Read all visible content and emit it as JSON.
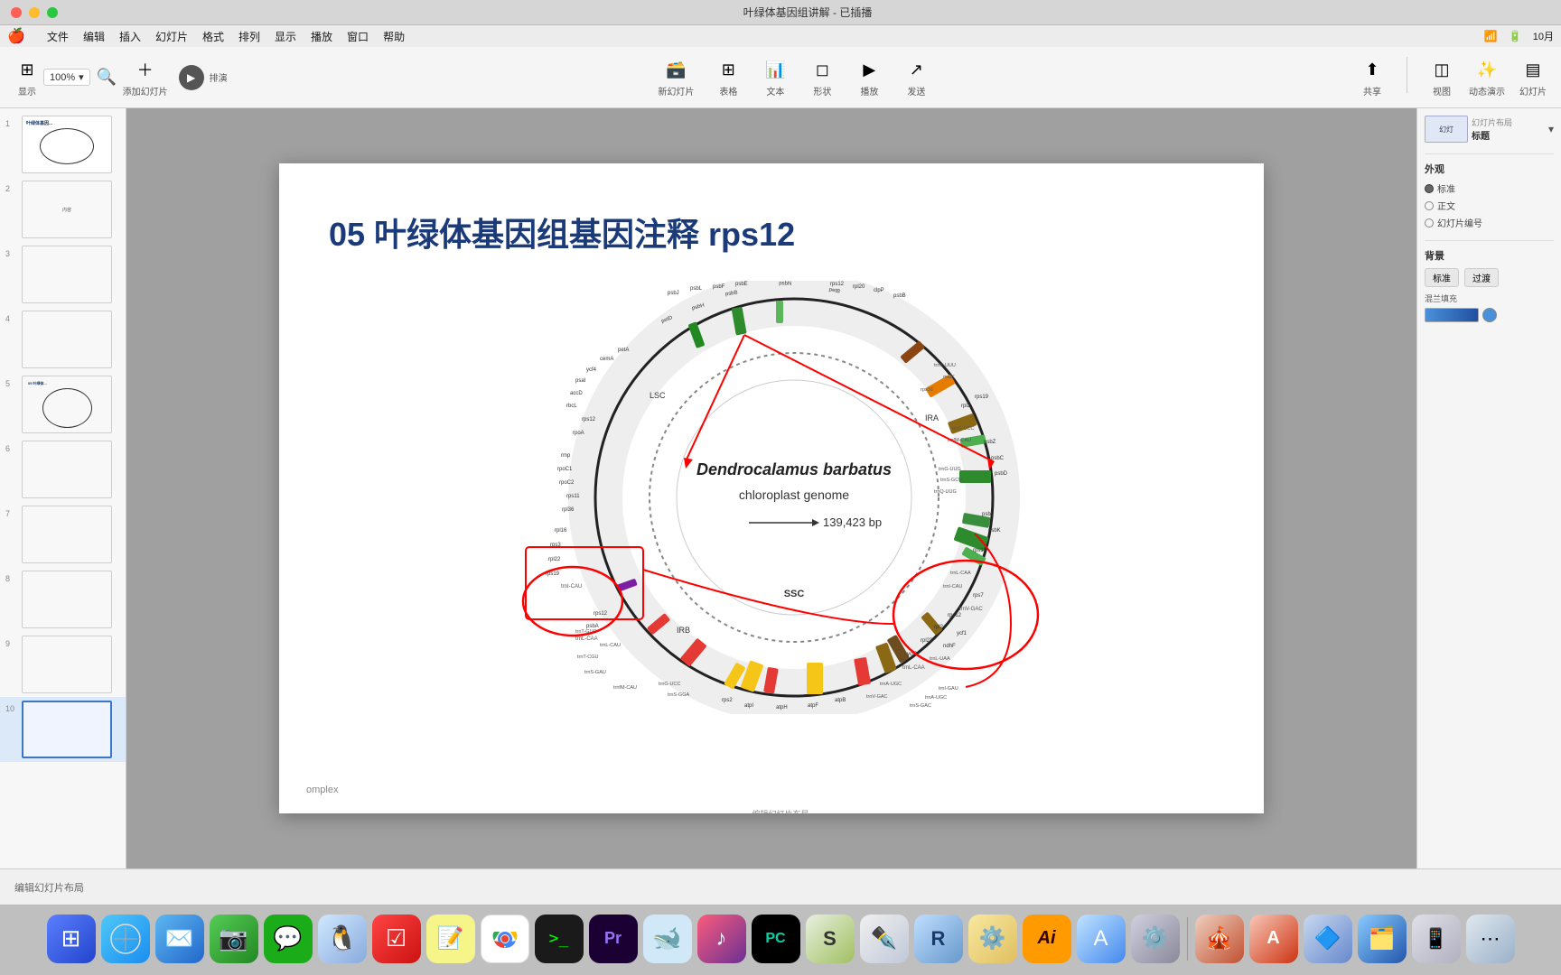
{
  "window": {
    "title": "叶绿体基因组讲解 - 已插播"
  },
  "menubar": {
    "apple": "🍎",
    "items": [
      "文件",
      "编辑",
      "插入",
      "幻灯片",
      "格式",
      "排列",
      "显示",
      "播放",
      "窗口",
      "帮助"
    ],
    "right_items": [
      "wifi-icon",
      "battery-icon",
      "clock-icon",
      "10月"
    ]
  },
  "toolbar": {
    "zoom_label": "100%",
    "display_label": "显示",
    "magnify_label": "缩放",
    "add_slide_label": "添加幻灯片",
    "play_label": "排演",
    "new_label": "新幻灯片",
    "table_label": "表格",
    "chart_label": "文本",
    "shapes_label": "形状",
    "operate_label": "播放",
    "send_label": "发送",
    "share_label": "共享",
    "view_label": "视图",
    "ai_tools_label": "动态演示",
    "slide_mgr_label": "幻灯片"
  },
  "slide": {
    "heading": "05 叶绿体基因组基因注释 rps12",
    "diagram": {
      "title_italic": "Dendrocalamus barbatus",
      "subtitle": "chlororoplast genome",
      "size": "139,423 bp",
      "inner_labels": [
        "LSC",
        "SSC",
        "IRB",
        "IRA"
      ]
    }
  },
  "right_panel": {
    "layout_section": "幻灯片布局",
    "layout_name": "标题",
    "appearance_title": "外观",
    "appearance_items": [
      "标准",
      "正文",
      "幻灯片编号"
    ],
    "background_title": "背景",
    "standard_btn": "标准",
    "transition_btn": "过渡",
    "color_label": "混兰填充",
    "footer_label": "编辑幻灯片布局"
  },
  "bottom_bar": {
    "status": "编辑幻灯片布局"
  },
  "dock": {
    "icons": [
      {
        "name": "launchpad",
        "emoji": "⊞",
        "color": "#e0e8f5",
        "label": "启动台"
      },
      {
        "name": "safari",
        "emoji": "🧭",
        "color": "#d0e8f8",
        "label": "Safari"
      },
      {
        "name": "mail",
        "emoji": "✉️",
        "color": "#d0e0f0",
        "label": "邮件"
      },
      {
        "name": "facetime",
        "emoji": "📷",
        "color": "#b8e8b8",
        "label": "FaceTime"
      },
      {
        "name": "wechat",
        "emoji": "💬",
        "color": "#b8e8b8",
        "label": "微信"
      },
      {
        "name": "qq",
        "emoji": "🐧",
        "color": "#d8e8f8",
        "label": "QQ"
      },
      {
        "name": "reminders",
        "emoji": "☑️",
        "color": "#f0e0d0",
        "label": "提醒事项"
      },
      {
        "name": "stickies",
        "emoji": "📝",
        "color": "#f8f0b0",
        "label": "便利贴"
      },
      {
        "name": "chrome",
        "emoji": "◎",
        "color": "#f0f0f0",
        "label": "Chrome"
      },
      {
        "name": "terminal",
        "emoji": "⬛",
        "color": "#222",
        "label": "终端"
      },
      {
        "name": "premiere",
        "emoji": "🎬",
        "color": "#200040",
        "label": "Premiere"
      },
      {
        "name": "docker",
        "emoji": "🐋",
        "color": "#d0e8f8",
        "label": "Docker"
      },
      {
        "name": "music",
        "emoji": "🎵",
        "color": "#f8d0d0",
        "label": "音乐"
      },
      {
        "name": "pycharm",
        "emoji": "🐍",
        "color": "#222",
        "label": "PyCharm"
      },
      {
        "name": "sublime",
        "emoji": "S",
        "color": "#e8f0e0",
        "label": "Sublime"
      },
      {
        "name": "vectornator",
        "emoji": "✒️",
        "color": "#f0f0f0",
        "label": "Vectornator"
      },
      {
        "name": "rstudio",
        "emoji": "R",
        "color": "#d0e8f8",
        "label": "RStudio"
      },
      {
        "name": "taskexplorer",
        "emoji": "⚙️",
        "color": "#f0e8d0",
        "label": "任务管理"
      },
      {
        "name": "illustrator",
        "emoji": "Ai",
        "color": "#ff9900",
        "label": "Illustrator"
      },
      {
        "name": "appstore",
        "emoji": "A",
        "color": "#d0e8f8",
        "label": "App Store"
      },
      {
        "name": "systemprefs",
        "emoji": "⚙️",
        "color": "#e0e0e8",
        "label": "系统偏好设置"
      },
      {
        "name": "keynote",
        "emoji": "K",
        "color": "#e8d0d0",
        "label": "Keynote"
      },
      {
        "name": "acrobat",
        "emoji": "A",
        "color": "#f0d0c8",
        "label": "Acrobat"
      },
      {
        "name": "3d",
        "emoji": "🔷",
        "color": "#c8d8f0",
        "label": "3D"
      },
      {
        "name": "finder",
        "emoji": "F",
        "color": "#d0e8f8",
        "label": "Finder"
      },
      {
        "name": "extra1",
        "emoji": "📱",
        "color": "#e8e8e8",
        "label": ""
      },
      {
        "name": "extra2",
        "emoji": "⋯",
        "color": "#e0e8f0",
        "label": ""
      }
    ]
  }
}
